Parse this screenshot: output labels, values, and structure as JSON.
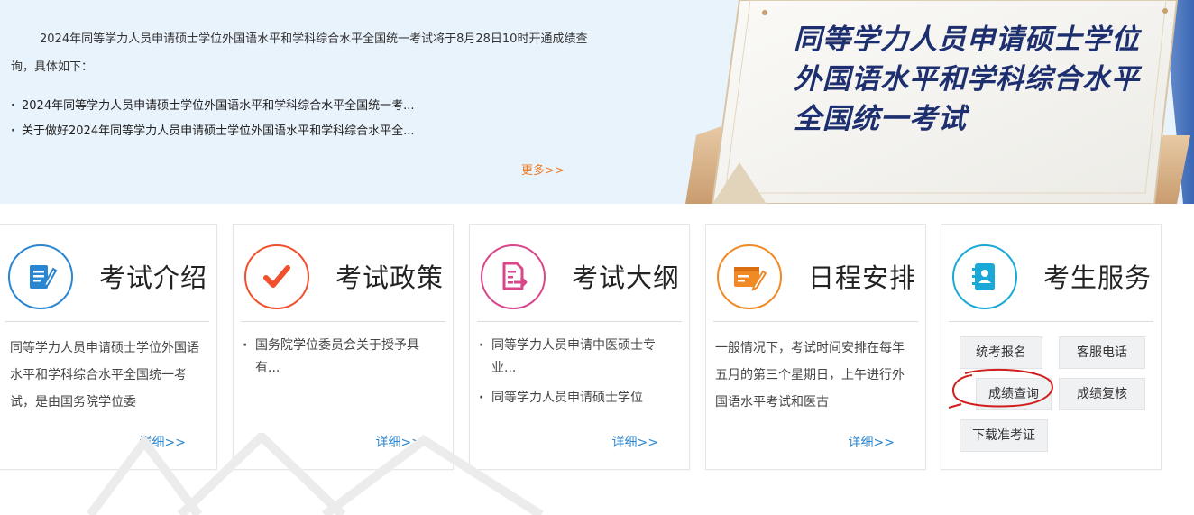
{
  "notice": {
    "paragraph": "2024年同等学力人员申请硕士学位外国语水平和学科综合水平全国统一考试将于8月28日10时开通成绩查询，具体如下：",
    "links": [
      "2024年同等学力人员申请硕士学位外国语水平和学科综合水平全国统一考...",
      "关于做好2024年同等学力人员申请硕士学位外国语水平和学科综合水平全..."
    ],
    "more": "更多>>"
  },
  "poster": {
    "line1": "同等学力人员申请硕士学位",
    "line2": "外国语水平和学科综合水平",
    "line3": "全国统一考试"
  },
  "cards": {
    "intro": {
      "title": "考试介绍",
      "body": "同等学力人员申请硕士学位外国语水平和学科综合水平全国统一考试，是由国务院学位委",
      "detail": "详细>>",
      "icon": "document-edit-icon",
      "color": "#2a86d0"
    },
    "policy": {
      "title": "考试政策",
      "items": [
        "国务院学位委员会关于授予具有..."
      ],
      "detail": "详细>>",
      "icon": "checkmark-icon",
      "color": "#f0502d"
    },
    "outline": {
      "title": "考试大纲",
      "items": [
        "同等学力人员申请中医硕士专业...",
        "同等学力人员申请硕士学位"
      ],
      "detail": "详细>>",
      "icon": "export-file-icon",
      "color": "#d9468a"
    },
    "schedule": {
      "title": "日程安排",
      "body": "一般情况下，考试时间安排在每年五月的第三个星期日，上午进行外国语水平考试和医古",
      "detail": "详细>>",
      "icon": "calendar-edit-icon",
      "color": "#f08a24"
    },
    "service": {
      "title": "考生服务",
      "icon": "contact-book-icon",
      "color": "#1aa9d6",
      "buttons": {
        "register": "统考报名",
        "hotline": "客服电话",
        "score": "成绩查询",
        "review": "成绩复核",
        "ticket": "下载准考证"
      }
    }
  }
}
